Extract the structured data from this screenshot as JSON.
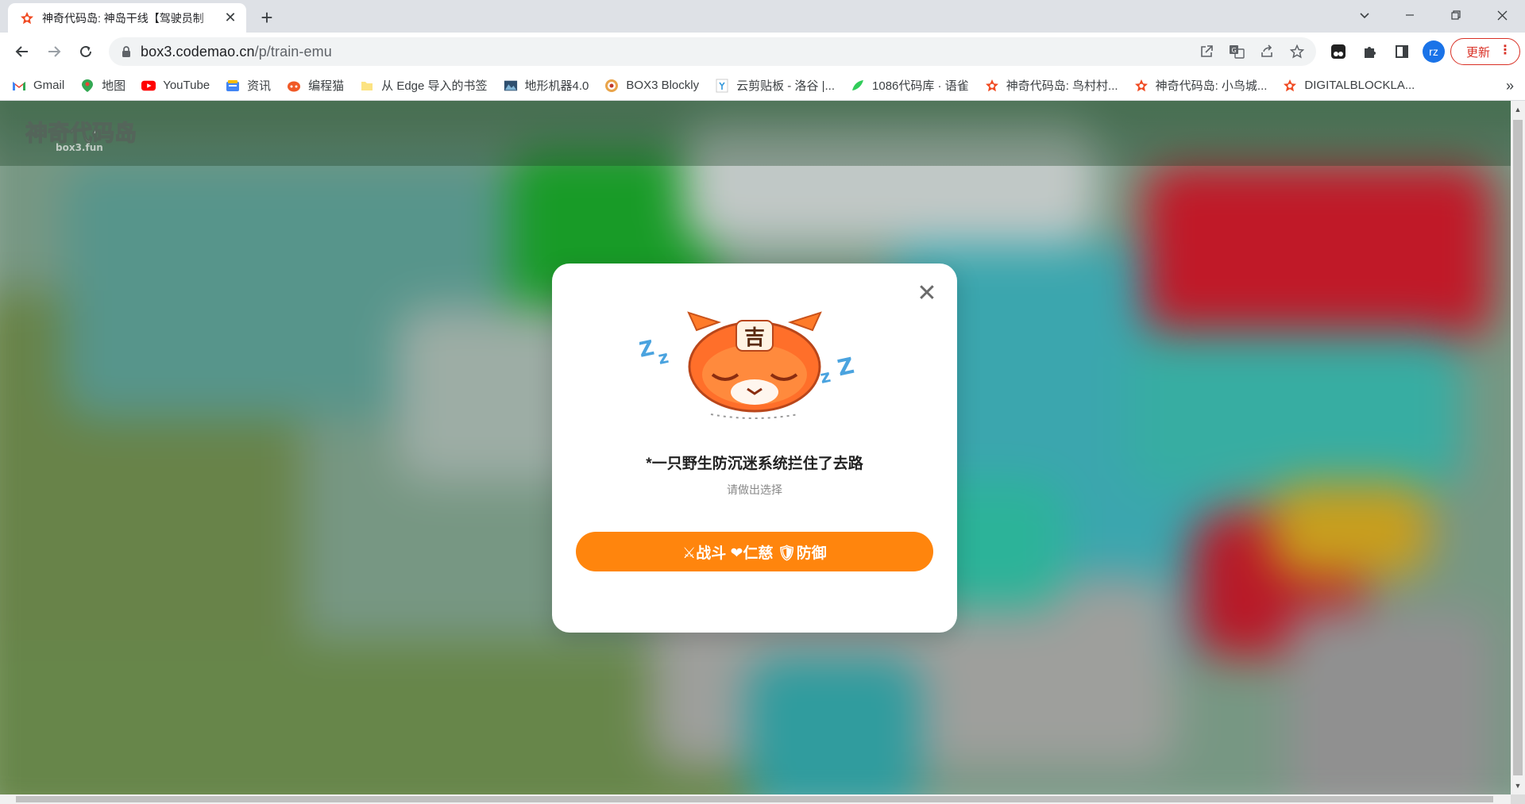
{
  "browser": {
    "tab_title": "神奇代码岛: 神岛干线【驾驶员制",
    "tab_close": "✕",
    "new_tab": "+",
    "url_host": "box3.codemao.cn",
    "url_path": "/p/train-emu",
    "avatar_initials": "rz",
    "update_label": "更新",
    "update_menu": "⋮"
  },
  "bookmarks": {
    "items": [
      {
        "label": "Gmail",
        "icon": "gmail-icon"
      },
      {
        "label": "地图",
        "icon": "maps-icon"
      },
      {
        "label": "YouTube",
        "icon": "youtube-icon"
      },
      {
        "label": "资讯",
        "icon": "news-icon"
      },
      {
        "label": "编程猫",
        "icon": "codemao-icon"
      },
      {
        "label": "从 Edge 导入的书签",
        "icon": "folder-icon"
      },
      {
        "label": "地形机器4.0",
        "icon": "terrain-icon"
      },
      {
        "label": "BOX3 Blockly",
        "icon": "blockly-icon"
      },
      {
        "label": "云剪贴板 - 洛谷 |...",
        "icon": "luogu-icon"
      },
      {
        "label": "1086代码库 · 语雀",
        "icon": "yuque-icon"
      },
      {
        "label": "神奇代码岛: 鸟村村...",
        "icon": "box3-icon"
      },
      {
        "label": "神奇代码岛: 小鸟城...",
        "icon": "box3-icon"
      },
      {
        "label": "DIGITALBLOCKLA...",
        "icon": "box3-icon"
      }
    ],
    "more": "»"
  },
  "site": {
    "logo_text": "神奇代码岛",
    "logo_sub": "box3.fun"
  },
  "modal": {
    "close": "✕",
    "title": "*一只野生防沉迷系统拦住了去路",
    "subtitle": "请做出选择",
    "action_label": "⚔战斗 ❤仁慈 🛡防御",
    "mascot_badge": "吉"
  },
  "colors": {
    "accent": "#ff850d",
    "update_red": "#d93025",
    "avatar_blue": "#1a73e8"
  }
}
